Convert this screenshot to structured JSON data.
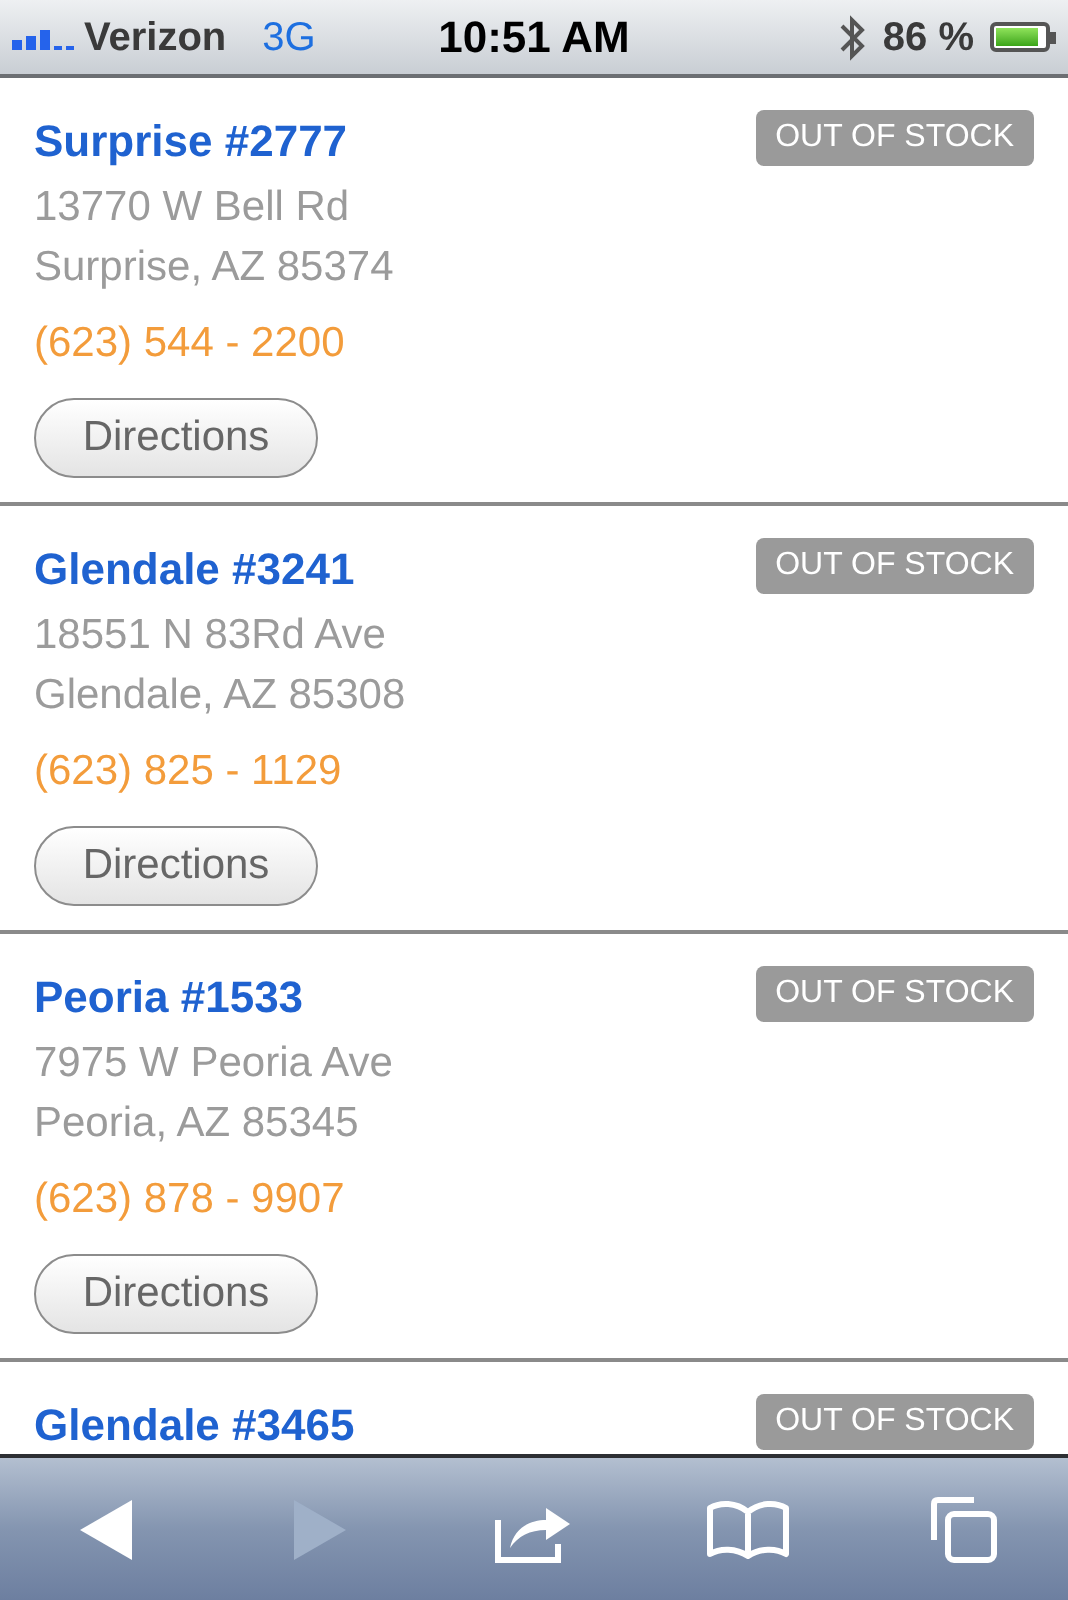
{
  "status_bar": {
    "carrier": "Verizon",
    "network": "3G",
    "time": "10:51 AM",
    "battery": {
      "percent": "86 %",
      "level": 0.86
    }
  },
  "stores": [
    {
      "name": "Surprise #2777",
      "stock": "OUT OF STOCK",
      "address_line_1": "13770 W Bell Rd",
      "address_line_2": "Surprise, AZ 85374",
      "phone": "(623) 544 - 2200",
      "directions": "Directions"
    },
    {
      "name": "Glendale #3241",
      "stock": "OUT OF STOCK",
      "address_line_1": "18551 N 83Rd Ave",
      "address_line_2": "Glendale, AZ 85308",
      "phone": "(623) 825 - 1129",
      "directions": "Directions"
    },
    {
      "name": "Peoria #1533",
      "stock": "OUT OF STOCK",
      "address_line_1": "7975 W Peoria Ave",
      "address_line_2": "Peoria, AZ 85345",
      "phone": "(623) 878 - 9907",
      "directions": "Directions"
    },
    {
      "name": "Glendale #3465",
      "stock": "OUT OF STOCK"
    }
  ],
  "toolbar": [
    {
      "kind": "back",
      "disabled": false
    },
    {
      "kind": "forward",
      "disabled": true
    },
    {
      "kind": "share",
      "disabled": false
    },
    {
      "kind": "bookmarks",
      "disabled": false
    },
    {
      "kind": "tabs",
      "disabled": false
    }
  ]
}
